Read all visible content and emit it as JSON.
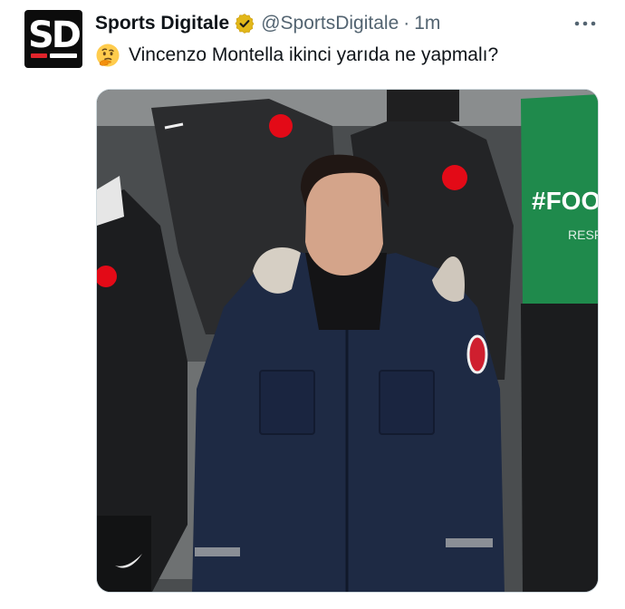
{
  "tweet": {
    "author": {
      "display_name": "Sports Digitale",
      "handle": "@SportsDigitale",
      "avatar_text": "SD",
      "verified": true
    },
    "separator": "·",
    "time": "1m",
    "emoji": "thinking-face",
    "text": "Vincenzo Montella ikinci yarıda ne yapmalı?",
    "media": {
      "type": "photo",
      "visible_text": [
        "#FOOT",
        "RESP"
      ]
    }
  },
  "colors": {
    "text_primary": "#0f1419",
    "text_secondary": "#536471",
    "verified_gold": "#e2b719",
    "avatar_bg": "#0c0c0c",
    "brand_red": "#e0242b"
  }
}
